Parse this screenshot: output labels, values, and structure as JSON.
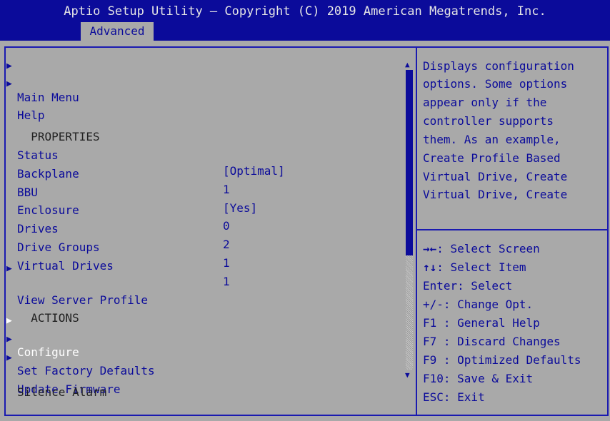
{
  "header": {
    "title": "Aptio Setup Utility – Copyright (C) 2019 American Megatrends, Inc.",
    "tab": "Advanced"
  },
  "menu": {
    "main_menu": "Main Menu",
    "help": "Help",
    "properties_heading": "PROPERTIES",
    "properties": [
      {
        "label": "Status",
        "value": "[Optimal]"
      },
      {
        "label": "Backplane",
        "value": "1"
      },
      {
        "label": "BBU",
        "value": "[Yes]"
      },
      {
        "label": "Enclosure",
        "value": "0"
      },
      {
        "label": "Drives",
        "value": "2"
      },
      {
        "label": "Drive Groups",
        "value": "1"
      },
      {
        "label": "Virtual Drives",
        "value": "1"
      }
    ],
    "view_server_profile": "View Server Profile",
    "actions_heading": "ACTIONS",
    "configure": "Configure",
    "set_factory_defaults": "Set Factory Defaults",
    "update_firmware": "Update Firmware",
    "silence_alarm": "Silence Alarm"
  },
  "help_text": [
    "Displays configuration",
    "options. Some options",
    "appear only if the",
    "controller supports",
    "them. As an example,",
    "Create Profile Based",
    "Virtual Drive, Create",
    "Virtual Drive, Create"
  ],
  "key_help": [
    {
      "key": "→←",
      "desc": ": Select Screen"
    },
    {
      "key": "↑↓",
      "desc": ": Select Item"
    },
    {
      "key": "",
      "desc": "Enter: Select"
    },
    {
      "key": "",
      "desc": "+/-: Change Opt."
    },
    {
      "key": "",
      "desc": "F1 : General Help"
    },
    {
      "key": "",
      "desc": "F7 : Discard Changes"
    },
    {
      "key": "",
      "desc": "F9 : Optimized Defaults"
    },
    {
      "key": "",
      "desc": "F10: Save & Exit"
    },
    {
      "key": "",
      "desc": "ESC: Exit"
    }
  ],
  "colors": {
    "background": "#a9a9a9",
    "title_bar": "#0b0b9a",
    "text_blue": "#0b0b9a",
    "selected_text": "#ffffff"
  }
}
